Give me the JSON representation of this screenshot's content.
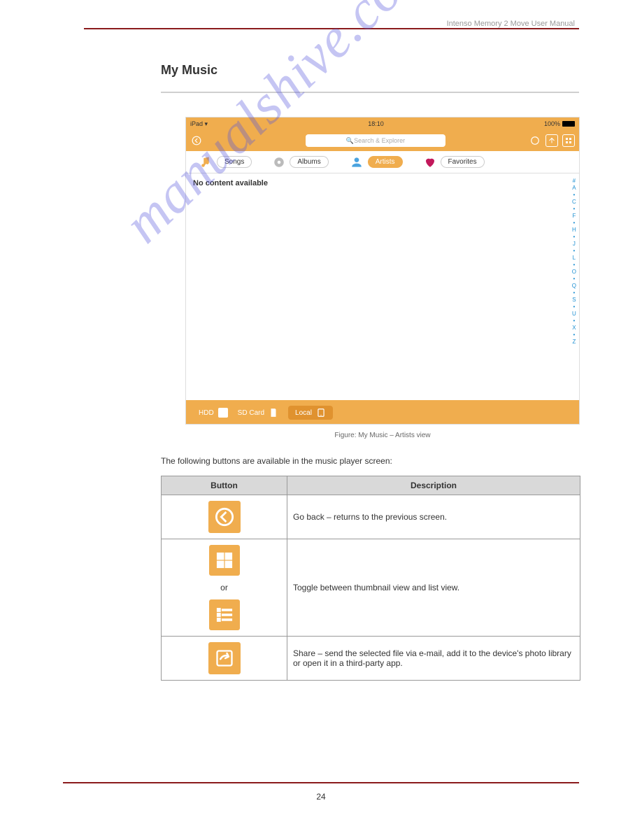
{
  "header_right": "Intenso Memory 2 Move User Manual",
  "section": {
    "title": "My Music"
  },
  "screenshot": {
    "status": {
      "device": "iPad",
      "time": "18:10",
      "battery": "100%"
    },
    "search_placeholder": "Search & Explorer",
    "tabs": {
      "songs": "Songs",
      "albums": "Albums",
      "artists": "Artists",
      "favorites": "Favorites"
    },
    "no_content": "No content available",
    "alpha": [
      "#",
      "A",
      "•",
      "C",
      "•",
      "F",
      "•",
      "H",
      "•",
      "J",
      "•",
      "L",
      "•",
      "O",
      "•",
      "Q",
      "•",
      "S",
      "•",
      "U",
      "•",
      "X",
      "•",
      "Z"
    ],
    "bottom": {
      "hdd": "HDD",
      "sdcard": "SD Card",
      "local": "Local"
    }
  },
  "caption": "Figure: My Music – Artists view",
  "description": "The following buttons are available in the music player screen:",
  "table": {
    "h1": "Button",
    "h2": "Description",
    "r1": "Go back – returns to the previous screen.",
    "or": "or",
    "r2": "Toggle between thumbnail view and list view.",
    "r3": "Share – send the selected file via e-mail, add it to the device's photo library or open it in a third-party app."
  },
  "page_number": "24"
}
